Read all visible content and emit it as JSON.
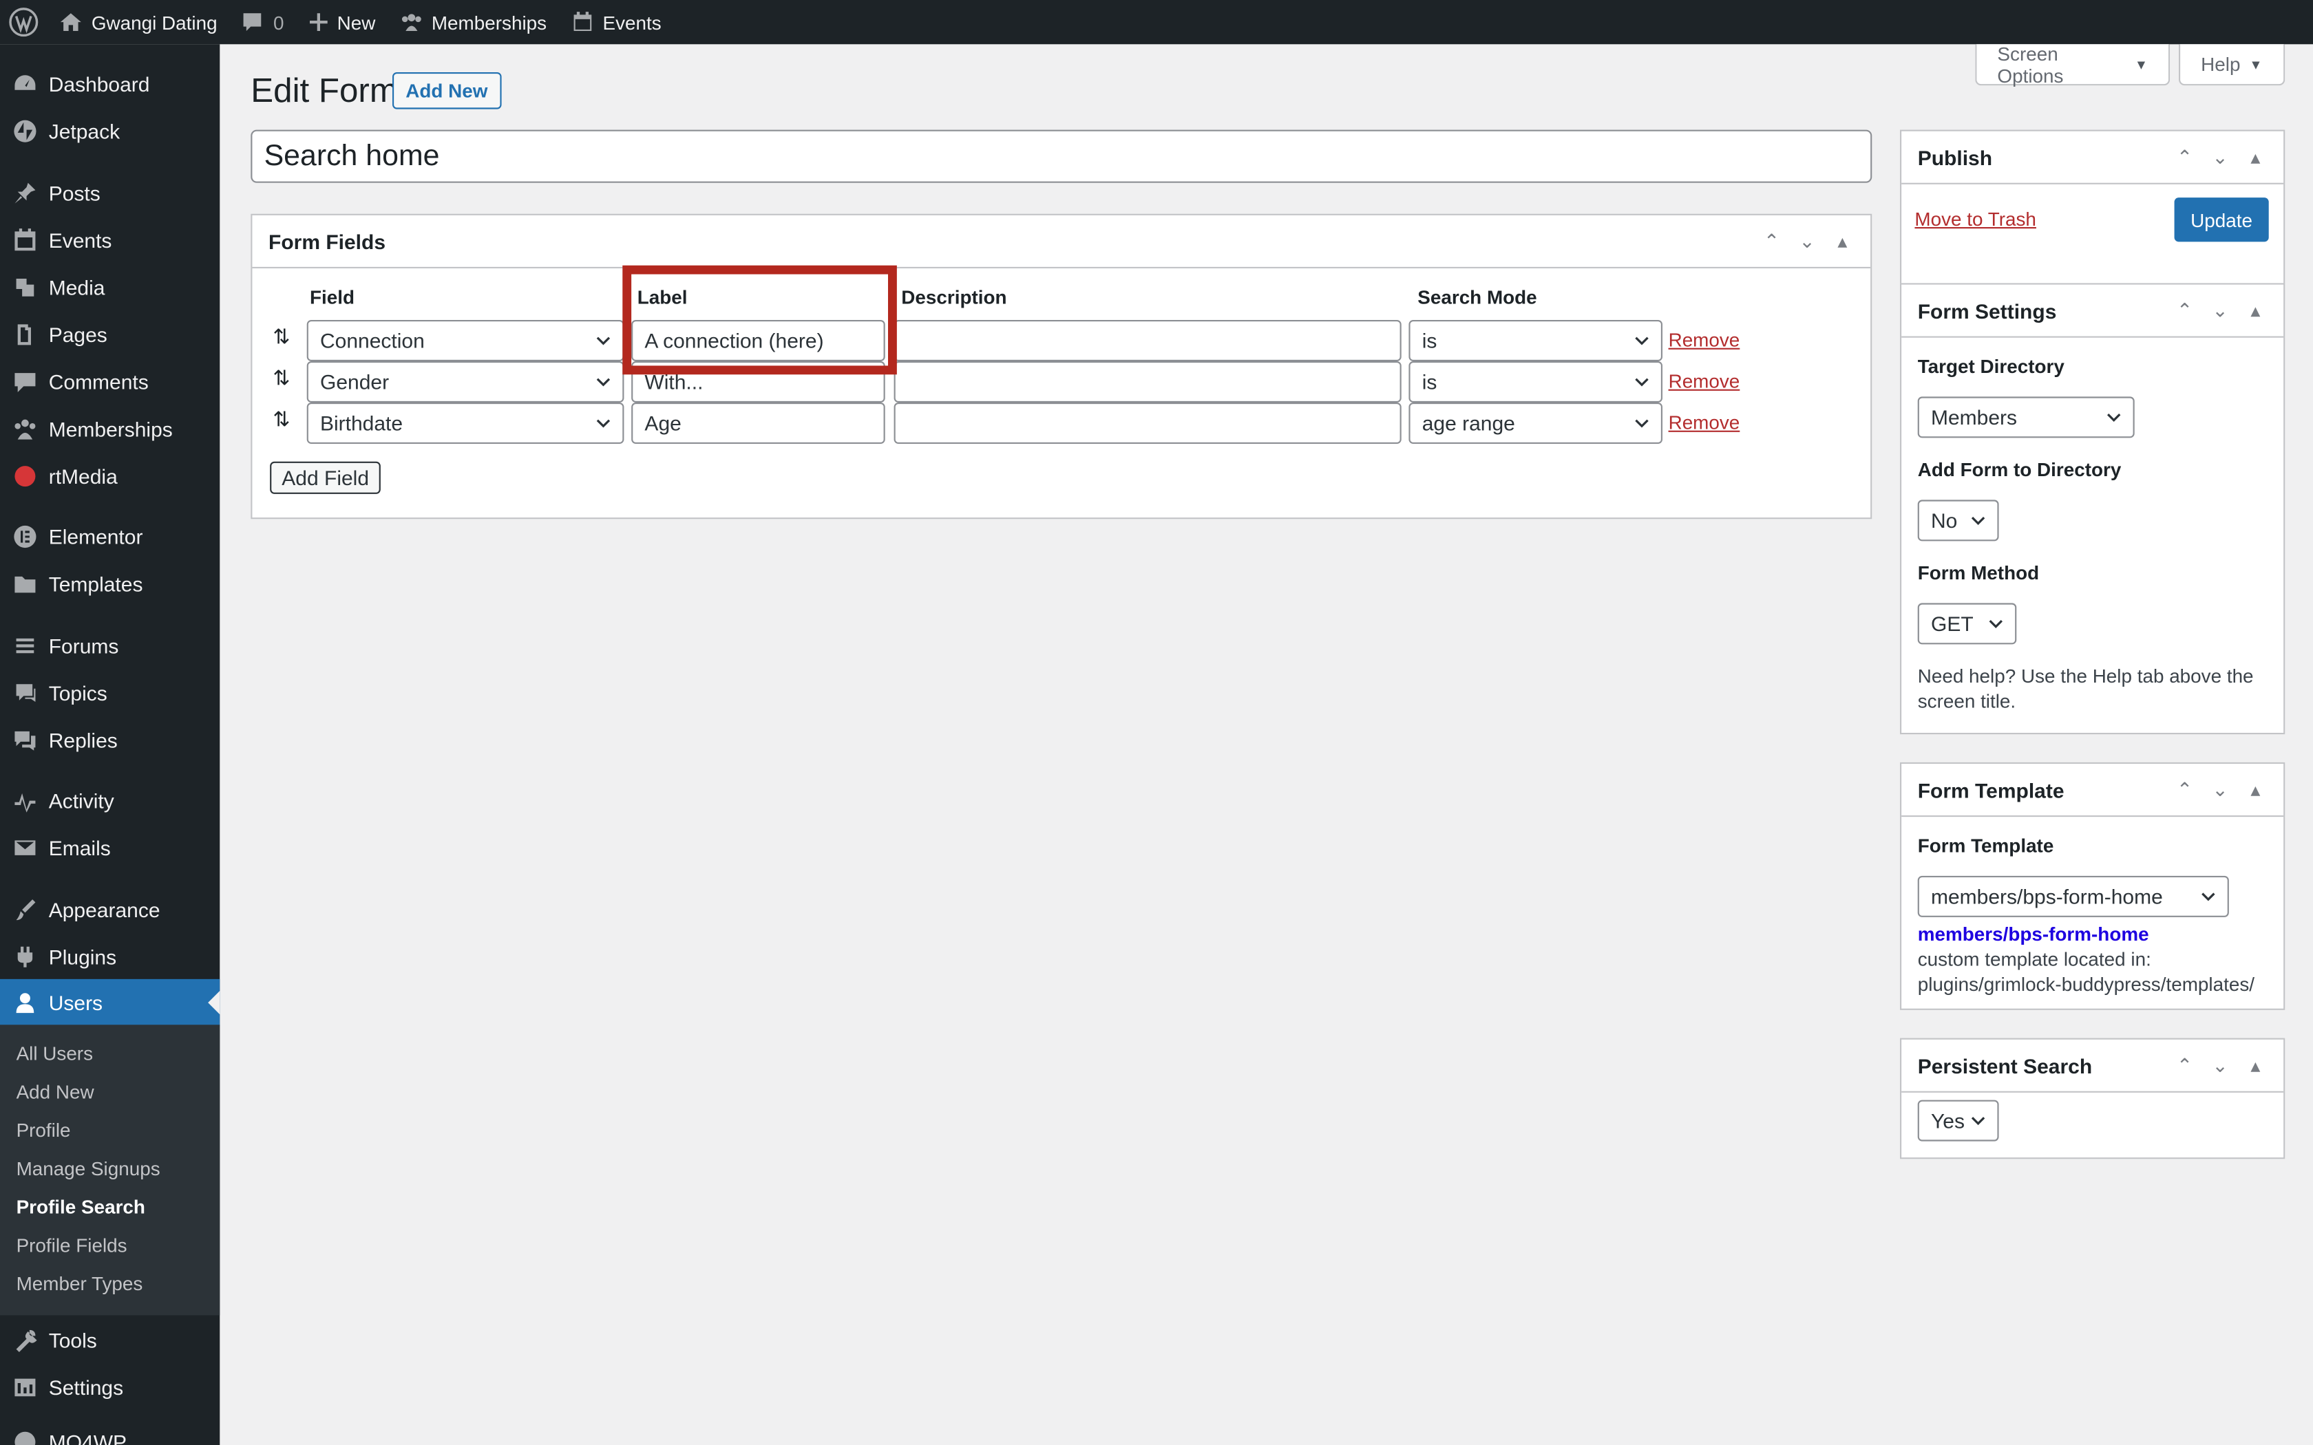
{
  "adminbar": {
    "site_name": "Gwangi Dating",
    "comments_count": "0",
    "new_label": "New",
    "memberships_label": "Memberships",
    "events_label": "Events"
  },
  "sidebar": {
    "items": [
      {
        "label": "Dashboard",
        "icon": "dashboard-icon"
      },
      {
        "label": "Jetpack",
        "icon": "jetpack-icon"
      },
      {
        "label": "Posts",
        "icon": "pin-icon"
      },
      {
        "label": "Events",
        "icon": "calendar-icon"
      },
      {
        "label": "Media",
        "icon": "media-icon"
      },
      {
        "label": "Pages",
        "icon": "page-icon"
      },
      {
        "label": "Comments",
        "icon": "comment-icon"
      },
      {
        "label": "Memberships",
        "icon": "groups-icon"
      },
      {
        "label": "rtMedia",
        "icon": "rtmedia-icon"
      },
      {
        "label": "Elementor",
        "icon": "elementor-icon"
      },
      {
        "label": "Templates",
        "icon": "folder-icon"
      },
      {
        "label": "Forums",
        "icon": "forums-icon"
      },
      {
        "label": "Topics",
        "icon": "topics-icon"
      },
      {
        "label": "Replies",
        "icon": "replies-icon"
      },
      {
        "label": "Activity",
        "icon": "activity-icon"
      },
      {
        "label": "Emails",
        "icon": "email-icon"
      },
      {
        "label": "Appearance",
        "icon": "brush-icon"
      },
      {
        "label": "Plugins",
        "icon": "plugin-icon"
      },
      {
        "label": "Users",
        "icon": "user-icon"
      },
      {
        "label": "Tools",
        "icon": "wrench-icon"
      },
      {
        "label": "Settings",
        "icon": "settings-icon"
      },
      {
        "label": "MO4WP",
        "icon": "mo4wp-icon"
      }
    ],
    "submenu": [
      "All Users",
      "Add New",
      "Profile",
      "Manage Signups",
      "Profile Search",
      "Profile Fields",
      "Member Types"
    ],
    "current_item": "Users",
    "current_sub": "Profile Search"
  },
  "header": {
    "screen_options": "Screen Options",
    "help": "Help",
    "title": "Edit Form",
    "add_new": "Add New",
    "form_title": "Search home"
  },
  "form_fields": {
    "title": "Form Fields",
    "columns": [
      "Field",
      "Label",
      "Description",
      "Search Mode"
    ],
    "rows": [
      {
        "field": "Connection",
        "label": "A connection (here)",
        "description": "",
        "mode": "is",
        "remove": "Remove"
      },
      {
        "field": "Gender",
        "label": "With...",
        "description": "",
        "mode": "is",
        "remove": "Remove"
      },
      {
        "field": "Birthdate",
        "label": "Age",
        "description": "",
        "mode": "age range",
        "remove": "Remove"
      }
    ],
    "add_field": "Add Field"
  },
  "publish": {
    "title": "Publish",
    "trash": "Move to Trash",
    "update": "Update"
  },
  "form_settings": {
    "title": "Form Settings",
    "target_directory_label": "Target Directory",
    "target_directory_value": "Members",
    "add_to_directory_label": "Add Form to Directory",
    "add_to_directory_value": "No",
    "method_label": "Form Method",
    "method_value": "GET",
    "help_text": "Need help? Use the Help tab above the screen title."
  },
  "form_template": {
    "title": "Form Template",
    "label": "Form Template",
    "value": "members/bps-form-home",
    "link": "members/bps-form-home",
    "note_line1": "custom template located in:",
    "note_line2": "plugins/grimlock-buddypress/templates/"
  },
  "persistent_search": {
    "title": "Persistent Search",
    "value": "Yes"
  },
  "colors": {
    "admin_dark": "#1d2327",
    "accent": "#2271b1",
    "highlight": "#b3281e",
    "danger": "#b32d2e"
  }
}
